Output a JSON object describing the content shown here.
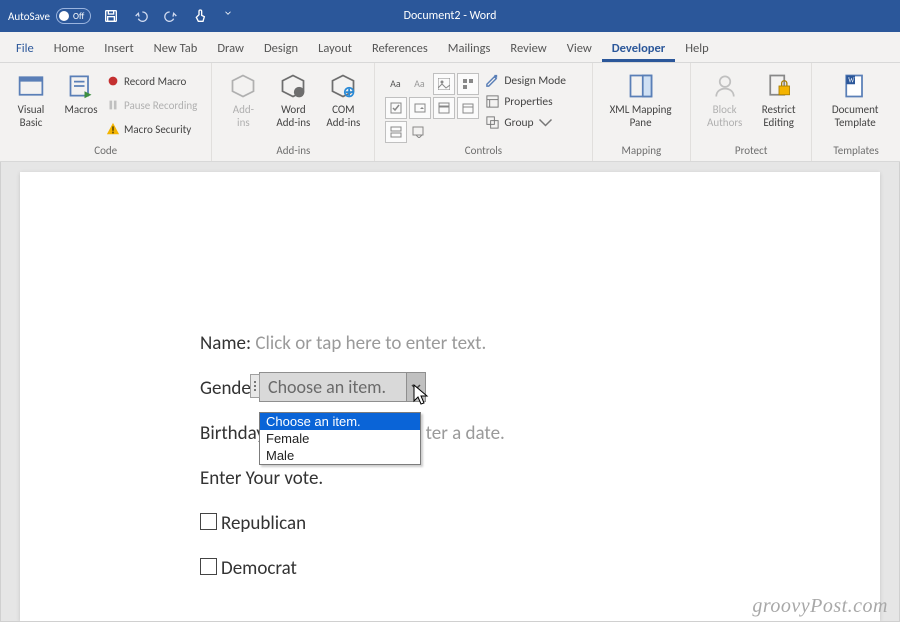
{
  "titlebar": {
    "autosave_label": "AutoSave",
    "autosave_state": "Off",
    "title": "Document2  -  Word"
  },
  "tabs": [
    "File",
    "Home",
    "Insert",
    "New Tab",
    "Draw",
    "Design",
    "Layout",
    "References",
    "Mailings",
    "Review",
    "View",
    "Developer",
    "Help"
  ],
  "active_tab": "Developer",
  "ribbon": {
    "code": {
      "label": "Code",
      "visual_basic": "Visual\nBasic",
      "macros": "Macros",
      "record": "Record Macro",
      "pause": "Pause Recording",
      "security": "Macro Security"
    },
    "addins": {
      "label": "Add-ins",
      "addins_btn": "Add-\nins",
      "word_addins": "Word\nAdd-ins",
      "com_addins": "COM\nAdd-ins"
    },
    "controls": {
      "label": "Controls",
      "design": "Design Mode",
      "properties": "Properties",
      "group": "Group"
    },
    "mapping": {
      "label": "Mapping",
      "btn": "XML Mapping\nPane"
    },
    "protect": {
      "label": "Protect",
      "block": "Block\nAuthors",
      "restrict": "Restrict\nEditing"
    },
    "templates": {
      "label": "Templates",
      "btn": "Document\nTemplate"
    }
  },
  "form": {
    "name_label": "Name:",
    "name_placeholder": "Click or tap here to enter text.",
    "gender_label": "Gender:",
    "gender_placeholder": "Choose an item.",
    "birthday_label": "Birthday",
    "birthday_placeholder": "ter a date.",
    "vote_label": "Enter Your vote.",
    "opt1": "Republican",
    "opt2": "Democrat"
  },
  "dropdown": {
    "selected": "Choose an item.",
    "items": [
      "Choose an item.",
      "Female",
      "Male"
    ]
  },
  "watermark": "groovyPost.com"
}
